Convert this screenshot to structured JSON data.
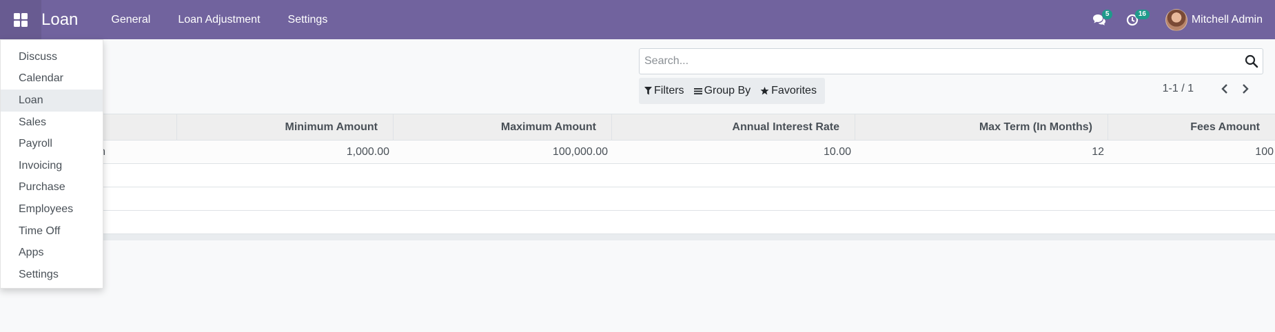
{
  "navbar": {
    "brand": "Loan",
    "menu": [
      "General",
      "Loan Adjustment",
      "Settings"
    ],
    "messages_badge": "5",
    "activities_badge": "16",
    "user_name": "Mitchell Admin",
    "accent_color": "#71639e"
  },
  "apps_menu": {
    "items": [
      {
        "label": "Discuss",
        "active": false
      },
      {
        "label": "Calendar",
        "active": false
      },
      {
        "label": "Loan",
        "active": true
      },
      {
        "label": "Sales",
        "active": false
      },
      {
        "label": "Payroll",
        "active": false
      },
      {
        "label": "Invoicing",
        "active": false
      },
      {
        "label": "Purchase",
        "active": false
      },
      {
        "label": "Employees",
        "active": false
      },
      {
        "label": "Time Off",
        "active": false
      },
      {
        "label": "Apps",
        "active": false
      },
      {
        "label": "Settings",
        "active": false
      }
    ]
  },
  "search": {
    "placeholder": "Search...",
    "value": ""
  },
  "filters": {
    "filters_label": "Filters",
    "group_by_label": "Group By",
    "favorites_label": "Favorites"
  },
  "pager": {
    "value": "1-1 / 1"
  },
  "table": {
    "columns": [
      "",
      "Minimum Amount",
      "Maximum Amount",
      "Annual Interest Rate",
      "Max Term (In Months)",
      "Fees Amount"
    ],
    "rows": [
      {
        "name_tail": "n",
        "min_amount": "1,000.00",
        "max_amount": "100,000.00",
        "rate": "10.00",
        "term": "12",
        "fees": "100"
      }
    ]
  }
}
